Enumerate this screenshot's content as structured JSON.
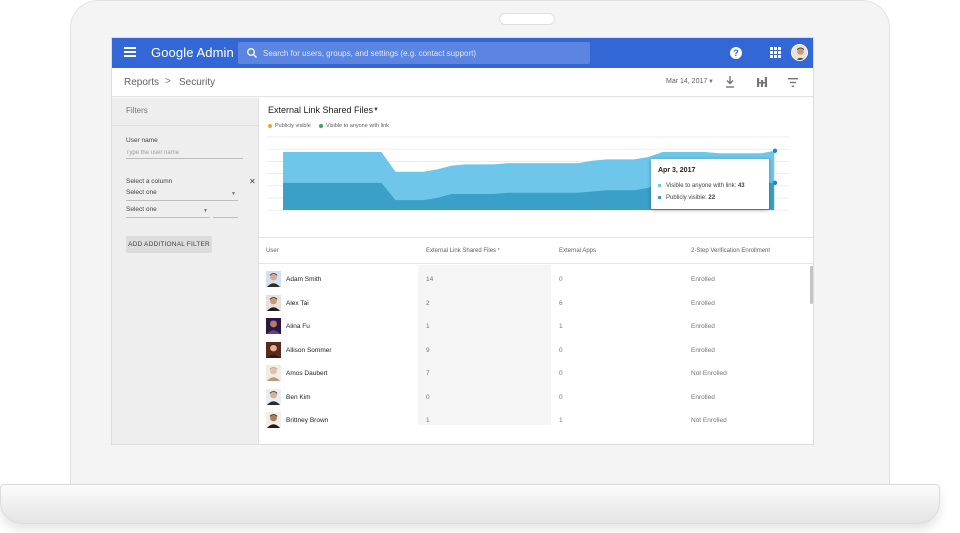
{
  "app": {
    "title": "Google Admin"
  },
  "search": {
    "placeholder": "Search for users, groups, and settings (e.g. contact support)"
  },
  "breadcrumb": {
    "items": [
      "Reports",
      "Security"
    ],
    "separator": ">"
  },
  "toolbar": {
    "date": "Mar 14, 2017"
  },
  "filters": {
    "title": "Filters",
    "user_name_label": "User name",
    "user_name_placeholder": "Type the user name",
    "select_column_label": "Select a column",
    "select_one_1": "Select one",
    "select_one_2": "Select one",
    "add_button": "ADD ADDITIONAL FILTER"
  },
  "chart": {
    "title": "External Link Shared Files",
    "legend": [
      {
        "label": "Publicly visible",
        "color": "#f4a22b"
      },
      {
        "label": "Visible to anyone with link",
        "color": "#34a853"
      }
    ],
    "tooltip": {
      "date": "Apr 3, 2017",
      "row1_label": "Visible to anyone with link:",
      "row1_value": "43",
      "row2_label": "Publicly visible:",
      "row2_value": "22"
    }
  },
  "chart_data": {
    "type": "area",
    "series": [
      {
        "name": "Visible to anyone with link",
        "values": [
          47,
          47,
          47,
          47,
          47,
          47,
          47,
          47,
          31,
          31,
          31,
          33,
          36,
          37,
          37,
          37,
          38,
          38,
          38,
          38,
          38,
          38,
          40,
          41,
          41,
          41,
          43,
          47,
          47,
          47,
          47,
          46,
          46,
          46,
          46,
          48
        ]
      },
      {
        "name": "Publicly visible",
        "values": [
          22,
          22,
          22,
          22,
          22,
          22,
          22,
          22,
          8,
          8,
          8,
          10,
          13,
          13,
          13,
          13,
          14,
          14,
          14,
          14,
          14,
          14,
          15,
          16,
          16,
          16,
          18,
          22,
          22,
          22,
          22,
          22,
          22,
          22,
          22,
          22
        ]
      }
    ],
    "colors": {
      "link": "#6ec6ea",
      "public": "#3aa0c8"
    }
  },
  "table": {
    "headers": [
      "User",
      "External Link Shared Files",
      "External Apps",
      "2-Step Verification Enrollment"
    ],
    "sort_mark": "*",
    "rows": [
      {
        "name": "Adam Smith",
        "files": "14",
        "apps": "0",
        "enrollment": "Enrolled"
      },
      {
        "name": "Alex Tai",
        "files": "2",
        "apps": "6",
        "enrollment": "Enrolled"
      },
      {
        "name": "Alina Fu",
        "files": "1",
        "apps": "1",
        "enrollment": "Enrolled"
      },
      {
        "name": "Allison Sommer",
        "files": "9",
        "apps": "0",
        "enrollment": "Enrolled"
      },
      {
        "name": "Amos Daubert",
        "files": "7",
        "apps": "0",
        "enrollment": "Not Enrolled"
      },
      {
        "name": "Ben Kim",
        "files": "0",
        "apps": "0",
        "enrollment": "Enrolled"
      },
      {
        "name": "Brittney Brown",
        "files": "1",
        "apps": "1",
        "enrollment": "Not Enrolled"
      }
    ]
  },
  "icons": {
    "menu": "menu-icon",
    "search": "search-icon",
    "help": "help-icon",
    "apps": "apps-grid-icon",
    "download": "download-icon",
    "columns": "columns-icon",
    "filter": "filter-list-icon"
  },
  "colors": {
    "appbar": "#3367d6",
    "accent": "#3367d6"
  }
}
